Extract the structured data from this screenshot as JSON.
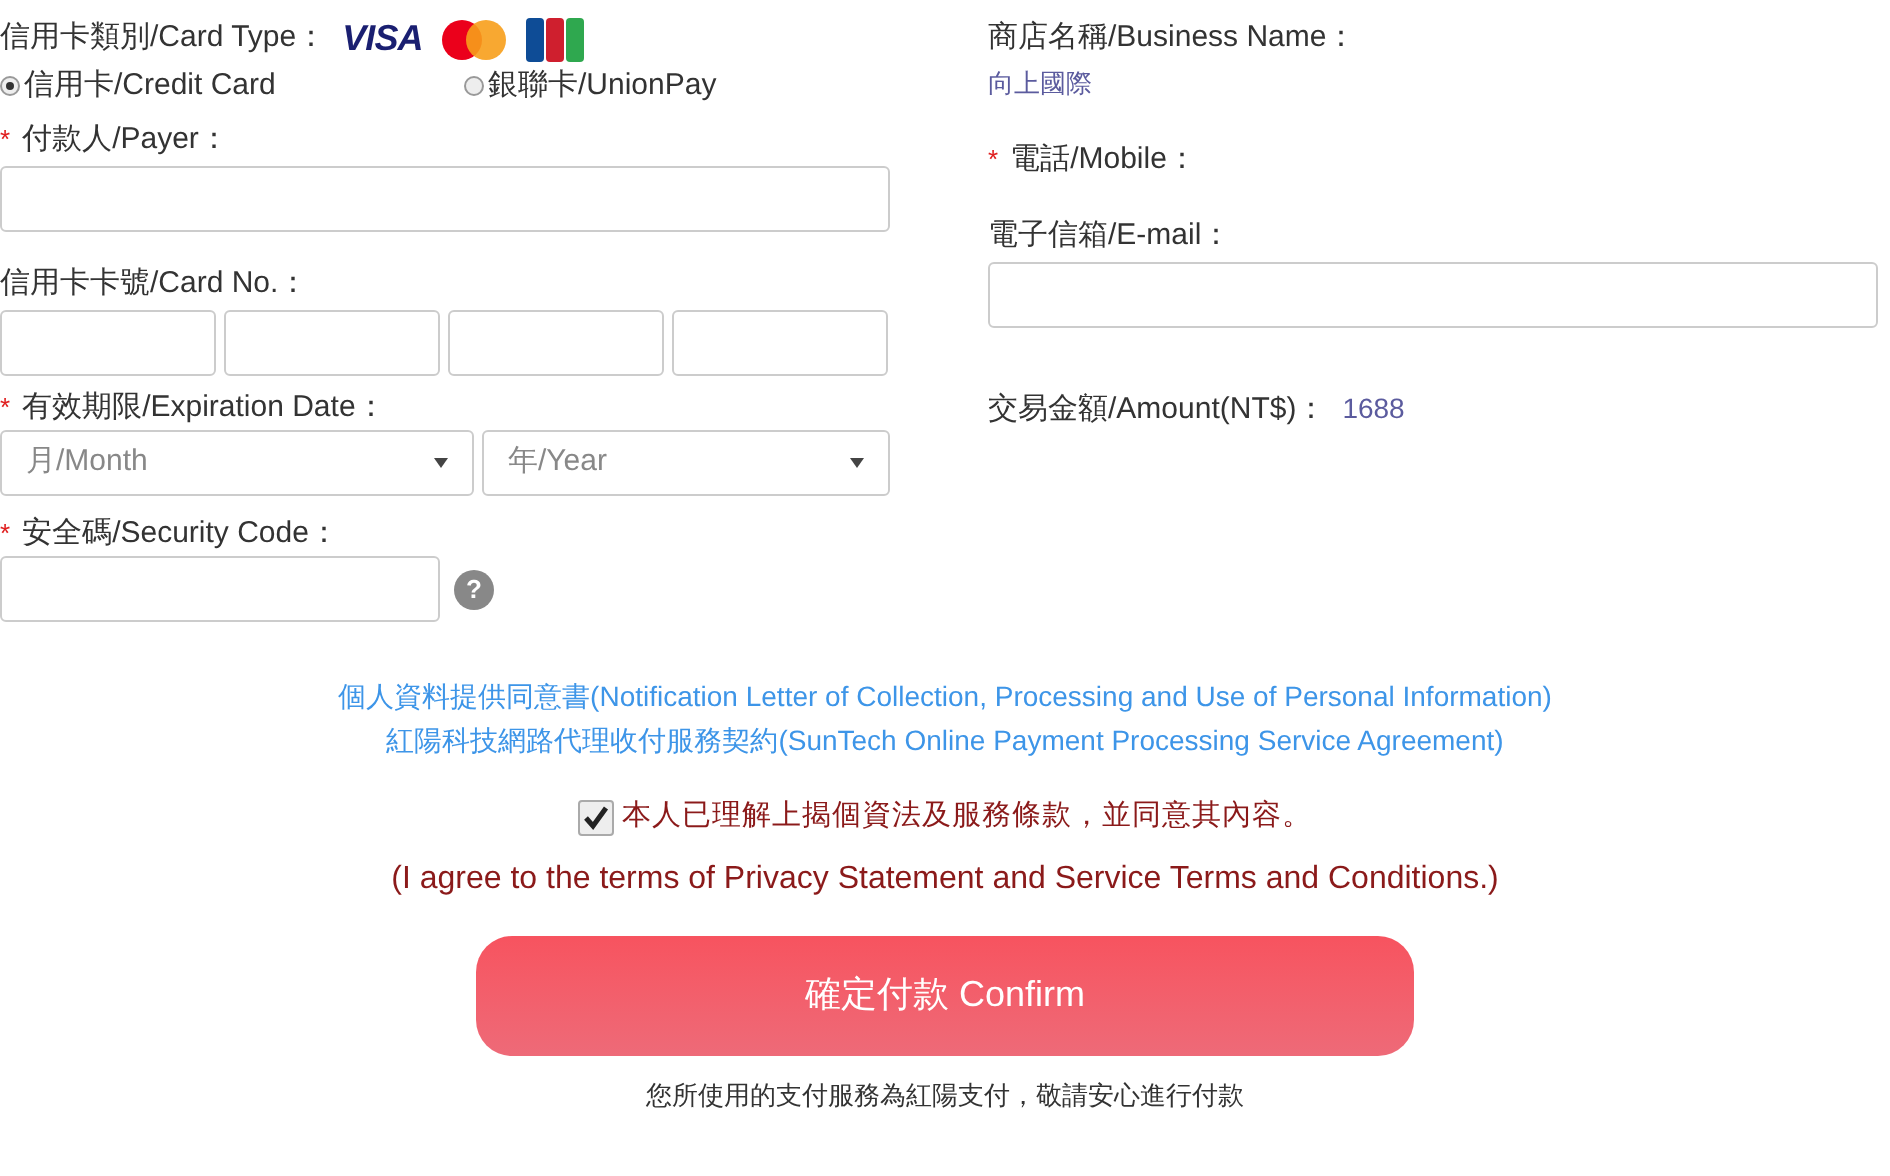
{
  "card_type": {
    "label": "信用卡類別/Card Type：",
    "visa_logo": "VISA",
    "options": [
      {
        "label": "信用卡/Credit Card",
        "selected": true
      },
      {
        "label": "銀聯卡/UnionPay",
        "selected": false
      }
    ]
  },
  "payer": {
    "required_mark": "*",
    "label": "付款人/Payer："
  },
  "card_no": {
    "label": "信用卡卡號/Card No.："
  },
  "expiration": {
    "required_mark": "*",
    "label": "有效期限/Expiration Date：",
    "month_placeholder": "月/Month",
    "year_placeholder": "年/Year"
  },
  "security_code": {
    "required_mark": "*",
    "label": "安全碼/Security Code：",
    "help": "?"
  },
  "business": {
    "label": "商店名稱/Business Name：",
    "value": "向上國際"
  },
  "mobile": {
    "required_mark": "*",
    "label": "電話/Mobile："
  },
  "email": {
    "label": "電子信箱/E-mail："
  },
  "amount": {
    "label": "交易金額/Amount(NT$)：",
    "value": "1688"
  },
  "links": [
    "個人資料提供同意書(Notification Letter of Collection, Processing and Use of Personal Information)",
    "紅陽科技網路代理收付服務契約(SunTech Online Payment Processing Service Agreement)"
  ],
  "agreement": {
    "checked": true,
    "text": "本人已理解上揭個資法及服務條款，並同意其內容。",
    "text_en": "(I agree to the terms of Privacy Statement and Service Terms and Conditions.)"
  },
  "confirm_button": "確定付款 Confirm",
  "footer_note": "您所使用的支付服務為紅陽支付，敬請安心進行付款"
}
